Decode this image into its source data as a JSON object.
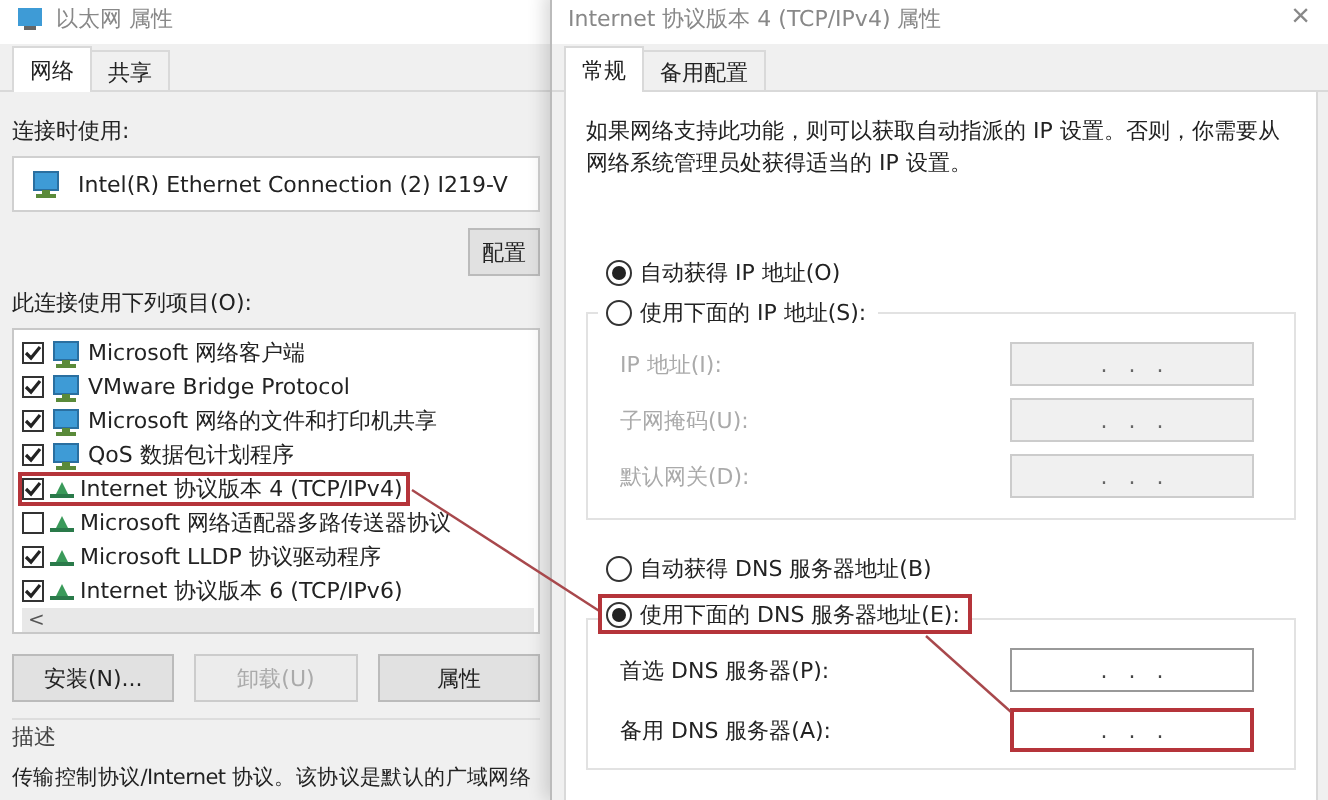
{
  "left_window": {
    "title": "以太网 属性",
    "tabs": [
      {
        "label": "网络",
        "selected": true
      },
      {
        "label": "共享",
        "selected": false
      }
    ],
    "connect_using_label": "连接时使用:",
    "adapter": "Intel(R) Ethernet Connection (2) I219-V",
    "configure_button": "配置",
    "items_label": "此连接使用下列项目(O):",
    "items": [
      {
        "label": "Microsoft 网络客户端",
        "checked": true,
        "kind": "service",
        "highlighted": false
      },
      {
        "label": "VMware Bridge Protocol",
        "checked": true,
        "kind": "service",
        "highlighted": false
      },
      {
        "label": "Microsoft 网络的文件和打印机共享",
        "checked": true,
        "kind": "service",
        "highlighted": false
      },
      {
        "label": "QoS 数据包计划程序",
        "checked": true,
        "kind": "service",
        "highlighted": false
      },
      {
        "label": "Internet 协议版本 4 (TCP/IPv4)",
        "checked": true,
        "kind": "protocol",
        "highlighted": true
      },
      {
        "label": "Microsoft 网络适配器多路传送器协议",
        "checked": false,
        "kind": "protocol",
        "highlighted": false
      },
      {
        "label": "Microsoft LLDP 协议驱动程序",
        "checked": true,
        "kind": "protocol",
        "highlighted": false
      },
      {
        "label": "Internet 协议版本 6 (TCP/IPv6)",
        "checked": true,
        "kind": "protocol",
        "highlighted": false
      }
    ],
    "scroll_left": "<",
    "buttons": [
      {
        "label": "安装(N)...",
        "disabled": false
      },
      {
        "label": "卸载(U)",
        "disabled": true
      },
      {
        "label": "属性",
        "disabled": false
      }
    ],
    "description_title": "描述",
    "description": "传输控制协议/Internet 协议。该协议是默认的广域网络"
  },
  "right_window": {
    "title": "Internet 协议版本 4 (TCP/IPv4) 属性",
    "close": "×",
    "tabs": [
      {
        "label": "常规",
        "selected": true
      },
      {
        "label": "备用配置",
        "selected": false
      }
    ],
    "intro": "如果网络支持此功能，则可以获取自动指派的 IP 设置。否则，你需要从网络系统管理员处获得适当的 IP 设置。",
    "ip_options": [
      {
        "label": "自动获得 IP 地址(O)",
        "selected": true,
        "highlighted": false
      },
      {
        "label": "使用下面的 IP 地址(S):",
        "selected": false,
        "highlighted": false
      }
    ],
    "ip_fields": [
      {
        "label": "IP 地址(I):",
        "value": ".   .   .",
        "disabled": true
      },
      {
        "label": "子网掩码(U):",
        "value": ".   .   .",
        "disabled": true
      },
      {
        "label": "默认网关(D):",
        "value": ".   .   .",
        "disabled": true
      }
    ],
    "dns_options": [
      {
        "label": "自动获得 DNS 服务器地址(B)",
        "selected": false,
        "highlighted": false
      },
      {
        "label": "使用下面的 DNS 服务器地址(E):",
        "selected": true,
        "highlighted": true
      }
    ],
    "dns_fields": [
      {
        "label": "首选 DNS 服务器(P):",
        "value": ".   .   .",
        "disabled": false,
        "highlighted": false
      },
      {
        "label": "备用 DNS 服务器(A):",
        "value": ".   .   .",
        "disabled": false,
        "highlighted": true
      }
    ]
  }
}
